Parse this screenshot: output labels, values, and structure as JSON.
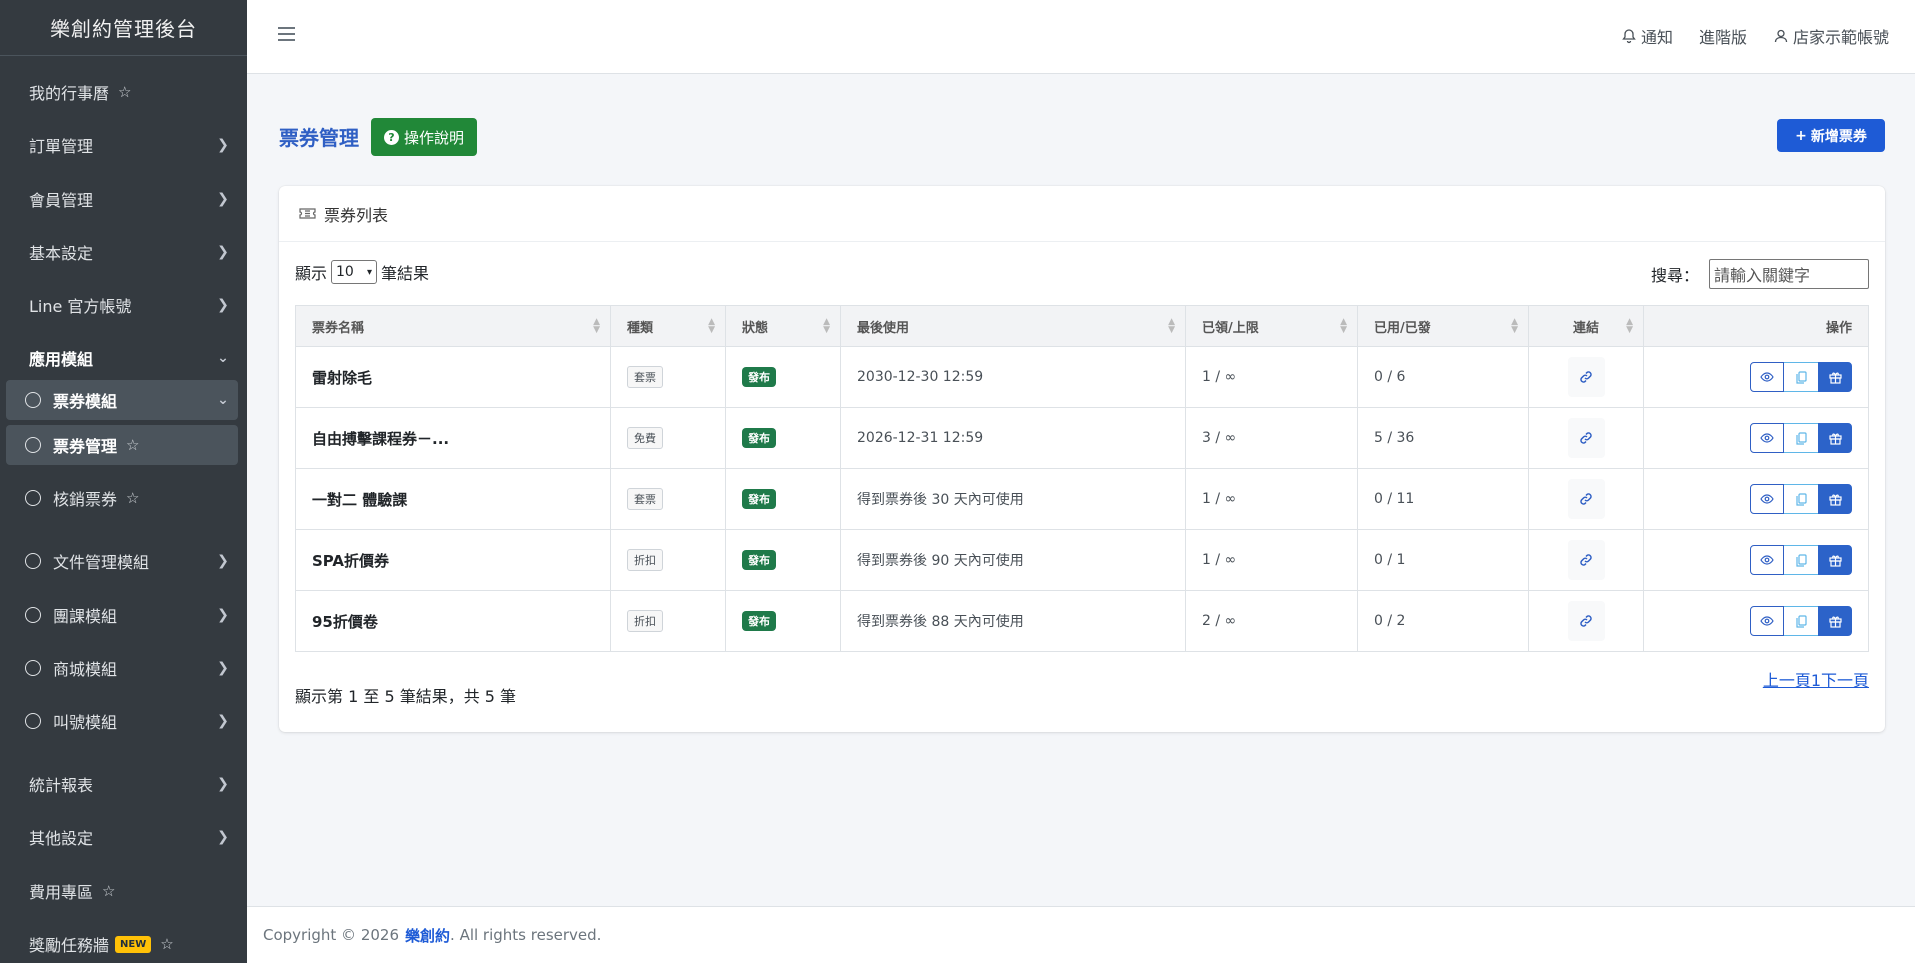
{
  "sidebar": {
    "brand": "樂創約管理後台",
    "items": [
      {
        "label": "我的行事曆",
        "star": "☆"
      },
      {
        "label": "訂單管理"
      },
      {
        "label": "會員管理"
      },
      {
        "label": "基本設定"
      },
      {
        "label": "Line 官方帳號"
      },
      {
        "label": "應用模組"
      },
      {
        "label": "票券模組"
      },
      {
        "label": "票券管理",
        "star": "☆"
      },
      {
        "label": "核銷票券",
        "star": "☆"
      },
      {
        "label": "文件管理模組"
      },
      {
        "label": "團課模組"
      },
      {
        "label": "商城模組"
      },
      {
        "label": "叫號模組"
      },
      {
        "label": "統計報表"
      },
      {
        "label": "其他設定"
      },
      {
        "label": "費用專區",
        "star": "☆"
      },
      {
        "label": "獎勵任務牆",
        "badge": "NEW",
        "star": "☆"
      }
    ]
  },
  "topbar": {
    "notify": "通知",
    "plan": "進階版",
    "account": "店家示範帳號"
  },
  "page": {
    "title": "票券管理",
    "help_label": "操作說明",
    "add_label": "新增票券"
  },
  "card": {
    "title": "票券列表",
    "show_prefix": "顯示",
    "page_size": "10",
    "show_suffix": "筆結果",
    "search_label": "搜尋：",
    "search_placeholder": "請輸入關鍵字",
    "columns": [
      "票券名稱",
      "種類",
      "狀態",
      "最後使用",
      "已領/上限",
      "已用/已發",
      "連結",
      "操作"
    ],
    "rows": [
      {
        "name": "雷射除毛",
        "type": "套票",
        "status": "發布",
        "last": "2030-12-30 12:59",
        "claimed": "1 / ∞",
        "used": "0 / 6"
      },
      {
        "name": "自由搏擊課程券－...",
        "type": "免費",
        "status": "發布",
        "last": "2026-12-31 12:59",
        "claimed": "3 / ∞",
        "used": "5 / 36"
      },
      {
        "name": "一對二 體驗課",
        "type": "套票",
        "status": "發布",
        "last": "得到票券後 30 天內可使用",
        "claimed": "1 / ∞",
        "used": "0 / 11"
      },
      {
        "name": "SPA折價券",
        "type": "折扣",
        "status": "發布",
        "last": "得到票券後 90 天內可使用",
        "claimed": "1 / ∞",
        "used": "0 / 1"
      },
      {
        "name": "95折價卷",
        "type": "折扣",
        "status": "發布",
        "last": "得到票券後 88 天內可使用",
        "claimed": "2 / ∞",
        "used": "0 / 2"
      }
    ],
    "info": "顯示第 1 至 5 筆結果，共 5 筆",
    "pager": "上一頁1下一頁"
  },
  "footer": {
    "copyright": "Copyright © 2026",
    "brand": "樂創約",
    "rights": ". All rights reserved."
  },
  "colors": {
    "sidebar_bg": "#343a40",
    "primary": "#1e5bd6",
    "success": "#218838",
    "badge_new": "#ffc107"
  }
}
